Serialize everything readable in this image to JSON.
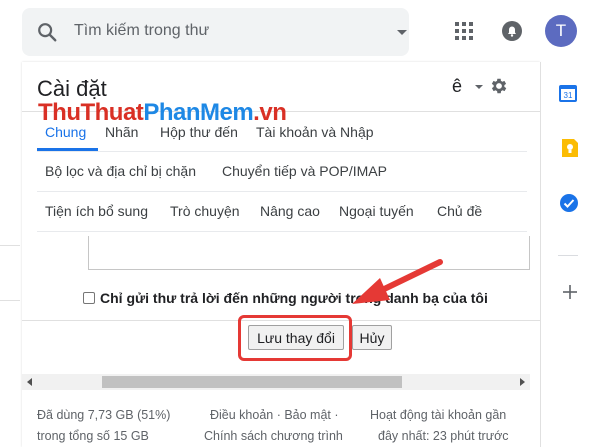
{
  "search": {
    "placeholder": "Tìm kiếm trong thư"
  },
  "account": {
    "avatar_letter": "T"
  },
  "settings": {
    "title": "Cài đặt",
    "lang_indicator": "ê",
    "watermark": {
      "part1": "ThuThuat",
      "part2": "PhanMem",
      "part3": ".vn"
    },
    "tabs_row1": [
      "Chung",
      "Nhãn",
      "Hộp thư đến",
      "Tài khoản và Nhập"
    ],
    "tabs_row2": [
      "Bộ lọc và địa chỉ bị chặn",
      "Chuyển tiếp và POP/IMAP"
    ],
    "tabs_row3": [
      "Tiện ích bổ sung",
      "Trò chuyện",
      "Nâng cao",
      "Ngoại tuyến",
      "Chủ đề"
    ],
    "active_tab": "Chung",
    "checkbox_label": "Chỉ gửi thư trả lời đến những người trong danh bạ của tôi",
    "save_label": "Lưu thay đổi",
    "cancel_label": "Hủy"
  },
  "footer": {
    "storage_line1": "Đã dùng 7,73 GB (51%)",
    "storage_line2": "trong tổng số 15 GB",
    "terms_line1": "Điều khoản · Bảo mật ·",
    "terms_line2": "Chính sách chương trình",
    "activity_line1": "Hoạt động tài khoản gần",
    "activity_line2": "đây nhất: 23 phút trước"
  },
  "colors": {
    "accent": "#1a73e8",
    "highlight": "#e53935",
    "avatar": "#5c6bc0"
  },
  "icons": {
    "search": "search-icon",
    "apps": "apps-grid-icon",
    "notifications": "notifications-icon",
    "settings": "gear-icon",
    "calendar": "calendar-icon",
    "keep": "keep-icon",
    "tasks": "tasks-icon",
    "add": "plus-icon"
  }
}
